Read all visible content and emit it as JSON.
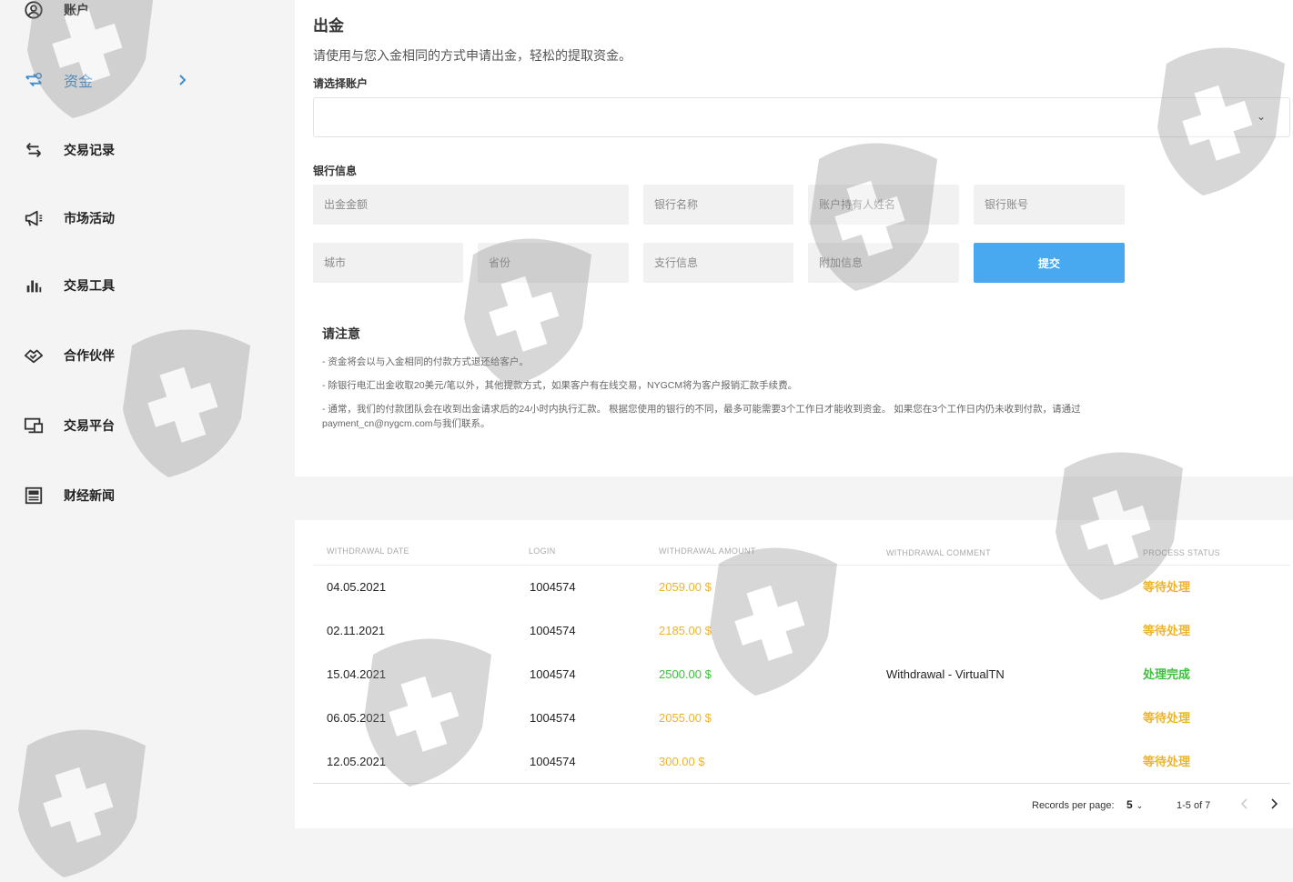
{
  "sidebar": {
    "items": [
      {
        "label": "账户",
        "icon": "account-circle-icon"
      },
      {
        "label": "资金",
        "icon": "funds-transfer-icon",
        "active": true
      },
      {
        "label": "交易记录",
        "icon": "transfer-arrows-icon"
      },
      {
        "label": "市场活动",
        "icon": "megaphone-icon"
      },
      {
        "label": "交易工具",
        "icon": "chart-bars-icon"
      },
      {
        "label": "合作伙伴",
        "icon": "handshake-icon"
      },
      {
        "label": "交易平台",
        "icon": "desktop-platform-icon"
      },
      {
        "label": "财经新闻",
        "icon": "newspaper-icon"
      }
    ]
  },
  "withdraw": {
    "title": "出金",
    "subtitle": "请使用与您入金相同的方式申请出金，轻松的提取资金。",
    "account_label": "请选择账户",
    "bank_label": "银行信息",
    "fields": {
      "amount": "出金金额",
      "bank_name": "银行名称",
      "holder_name": "账户持有人姓名",
      "account_number": "银行账号",
      "city": "城市",
      "province": "省份",
      "branch": "支行信息",
      "extra": "附加信息"
    },
    "submit": "提交"
  },
  "notice": {
    "title": "请注意",
    "lines": [
      "- 资金将会以与入金相同的付款方式退还给客户。",
      "- 除银行电汇出金收取20美元/笔以外，其他提款方式，如果客户有在线交易，NYGCM将为客户报销汇款手续费。",
      "- 通常，我们的付款团队会在收到出金请求后的24小时内执行汇款。 根据您使用的银行的不同，最多可能需要3个工作日才能收到资金。 如果您在3个工作日内仍未收到付款，请通过payment_cn@nygcm.com与我们联系。"
    ]
  },
  "table": {
    "headers": [
      "WITHDRAWAL DATE",
      "LOGIN",
      "WITHDRAWAL AMOUNT",
      "WITHDRAWAL COMMENT",
      "PROCESS STATUS"
    ],
    "rows": [
      {
        "date": "04.05.2021",
        "login": "1004574",
        "amount": "2059.00 $",
        "comment": "",
        "status": "等待处理",
        "state": "pending"
      },
      {
        "date": "02.11.2021",
        "login": "1004574",
        "amount": "2185.00 $",
        "comment": "",
        "status": "等待处理",
        "state": "pending"
      },
      {
        "date": "15.04.2021",
        "login": "1004574",
        "amount": "2500.00 $",
        "comment": "Withdrawal - VirtualTN",
        "status": "处理完成",
        "state": "done"
      },
      {
        "date": "06.05.2021",
        "login": "1004574",
        "amount": "2055.00 $",
        "comment": "",
        "status": "等待处理",
        "state": "pending"
      },
      {
        "date": "12.05.2021",
        "login": "1004574",
        "amount": "300.00 $",
        "comment": "",
        "status": "等待处理",
        "state": "pending"
      }
    ],
    "pager": {
      "records_label": "Records per page:",
      "per_page": "5",
      "range": "1-5 of 7"
    }
  },
  "colors": {
    "accent": "#3c8ccf",
    "submit": "#48a8f0",
    "pending": "#f0b429",
    "done": "#3cc13b"
  }
}
